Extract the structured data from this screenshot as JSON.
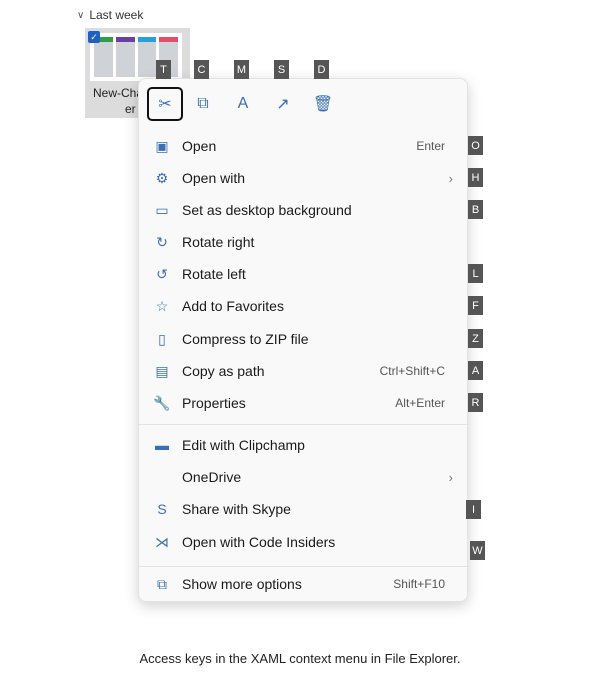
{
  "group": {
    "label": "Last week"
  },
  "file": {
    "name_line1": "New-Cha",
    "name_line2": "er"
  },
  "toolbar": [
    {
      "name": "cut",
      "icon": "scissors-icon",
      "glyph": "✂",
      "key": "T"
    },
    {
      "name": "copy",
      "icon": "copy-icon",
      "glyph": "⧉",
      "key": "C"
    },
    {
      "name": "rename",
      "icon": "rename-icon",
      "glyph": "A",
      "key": "M"
    },
    {
      "name": "share",
      "icon": "share-icon",
      "glyph": "↗",
      "key": "S"
    },
    {
      "name": "delete",
      "icon": "trash-icon",
      "glyph": "🗑",
      "key": "D"
    }
  ],
  "items": [
    {
      "label": "Open",
      "shortcut": "Enter",
      "key": "O",
      "icon": "photos-icon",
      "glyph": "▣"
    },
    {
      "label": "Open with",
      "submenu": true,
      "key": "H",
      "icon": "open-with-icon",
      "glyph": "⚙"
    },
    {
      "label": "Set as desktop background",
      "key": "B",
      "icon": "desktop-background-icon",
      "glyph": "▭"
    },
    {
      "label": "Rotate right",
      "icon": "rotate-right-icon",
      "glyph": "↻"
    },
    {
      "label": "Rotate left",
      "key": "L",
      "icon": "rotate-left-icon",
      "glyph": "↺"
    },
    {
      "label": "Add to Favorites",
      "key": "F",
      "icon": "star-icon",
      "glyph": "☆"
    },
    {
      "label": "Compress to ZIP file",
      "key": "Z",
      "icon": "zip-icon",
      "glyph": "▯"
    },
    {
      "label": "Copy as path",
      "shortcut": "Ctrl+Shift+C",
      "key": "A",
      "icon": "copy-path-icon",
      "glyph": "▤"
    },
    {
      "label": "Properties",
      "shortcut": "Alt+Enter",
      "key": "R",
      "icon": "wrench-icon",
      "glyph": "🔧"
    },
    {
      "label": "Edit with Clipchamp",
      "icon": "clipchamp-icon",
      "glyph": "▬"
    },
    {
      "label": "OneDrive",
      "submenu": true
    },
    {
      "label": "Share with Skype",
      "key": "I",
      "icon": "skype-icon",
      "glyph": "S"
    },
    {
      "label": "Open with Code Insiders",
      "key": "W",
      "icon": "vscode-icon",
      "glyph": "⋊"
    },
    {
      "label": "Show more options",
      "shortcut": "Shift+F10",
      "icon": "more-options-icon",
      "glyph": "⧉"
    }
  ],
  "caption": "Access keys in the XAML context menu in File Explorer."
}
